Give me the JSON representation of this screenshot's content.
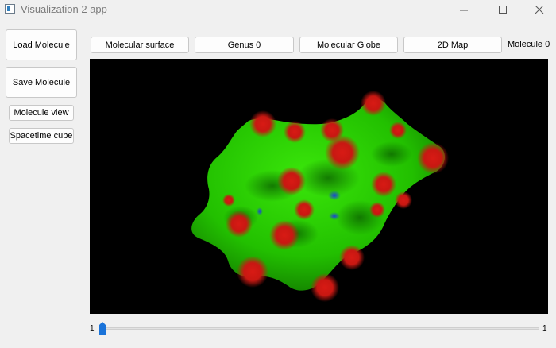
{
  "window": {
    "title": "Visualization 2 app"
  },
  "sidebar": {
    "load_label": "Load Molecule",
    "save_label": "Save Molecule",
    "molecule_view_label": "Molecule view",
    "spacetime_label": "Spacetime cube"
  },
  "toolbar": {
    "surface_label": "Molecular surface",
    "genus_label": "Genus 0",
    "globe_label": "Molecular Globe",
    "map_label": "2D Map",
    "molecule_indicator": "Molecule 0"
  },
  "viewport": {
    "background": "#000000",
    "surface_colors": {
      "base": "#2bd400",
      "hydrophobic_high": "#d81a14",
      "hydrophilic": "#1a3ee0"
    }
  },
  "slider": {
    "min_label": "1",
    "max_label": "1",
    "value": 1,
    "accent": "#1a73d9"
  }
}
